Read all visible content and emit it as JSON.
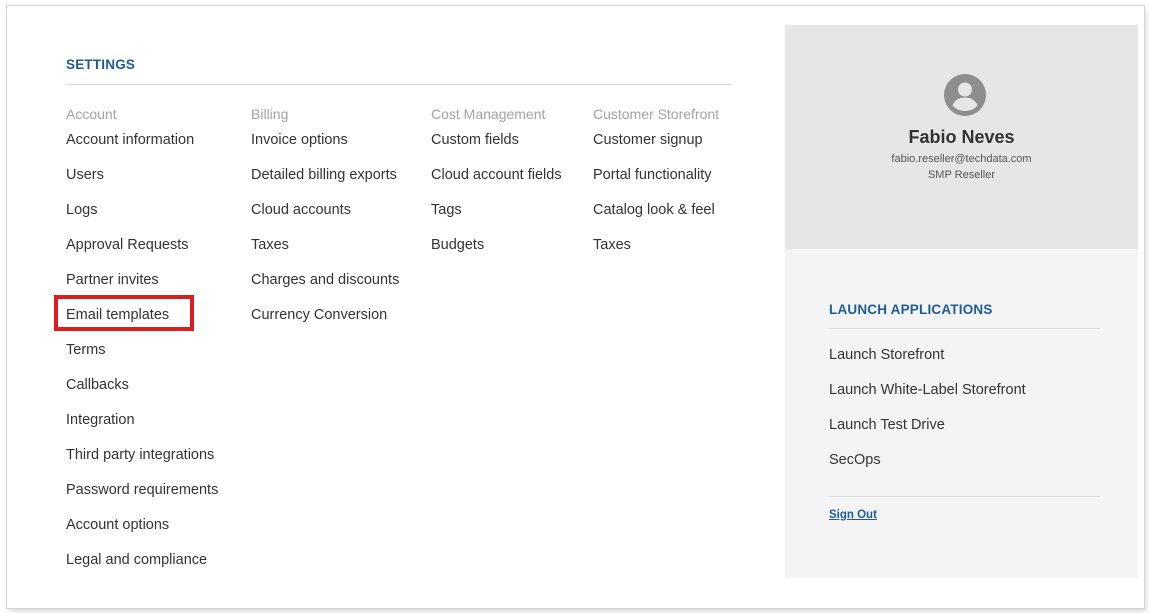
{
  "settings": {
    "title": "SETTINGS",
    "columns": [
      {
        "header": "Account",
        "items": [
          "Account information",
          "Users",
          "Logs",
          "Approval Requests",
          "Partner invites",
          "Email templates",
          "Terms",
          "Callbacks",
          "Integration",
          "Third party integrations",
          "Password requirements",
          "Account options",
          "Legal and compliance"
        ]
      },
      {
        "header": "Billing",
        "items": [
          "Invoice options",
          "Detailed billing exports",
          "Cloud accounts",
          "Taxes",
          "Charges and discounts",
          "Currency Conversion"
        ]
      },
      {
        "header": "Cost Management",
        "items": [
          "Custom fields",
          "Cloud account fields",
          "Tags",
          "Budgets"
        ]
      },
      {
        "header": "Customer Storefront",
        "items": [
          "Customer signup",
          "Portal functionality",
          "Catalog look & feel",
          "Taxes"
        ]
      }
    ],
    "highlighted_item": "Email templates",
    "highlight_color": "#e11b22"
  },
  "profile": {
    "avatar_icon": "user-avatar-icon",
    "name": "Fabio Neves",
    "email": "fabio.reseller@techdata.com",
    "role": "SMP Reseller"
  },
  "launch": {
    "title": "LAUNCH APPLICATIONS",
    "items": [
      "Launch Storefront",
      "Launch White-Label Storefront",
      "Launch Test Drive",
      "SecOps"
    ],
    "sign_out": "Sign Out"
  },
  "colors": {
    "accent": "#1d5c96",
    "text": "#333333",
    "muted": "#a3a3a3",
    "profile_bg": "#e6e6e6",
    "launch_bg": "#f4f4f4"
  }
}
